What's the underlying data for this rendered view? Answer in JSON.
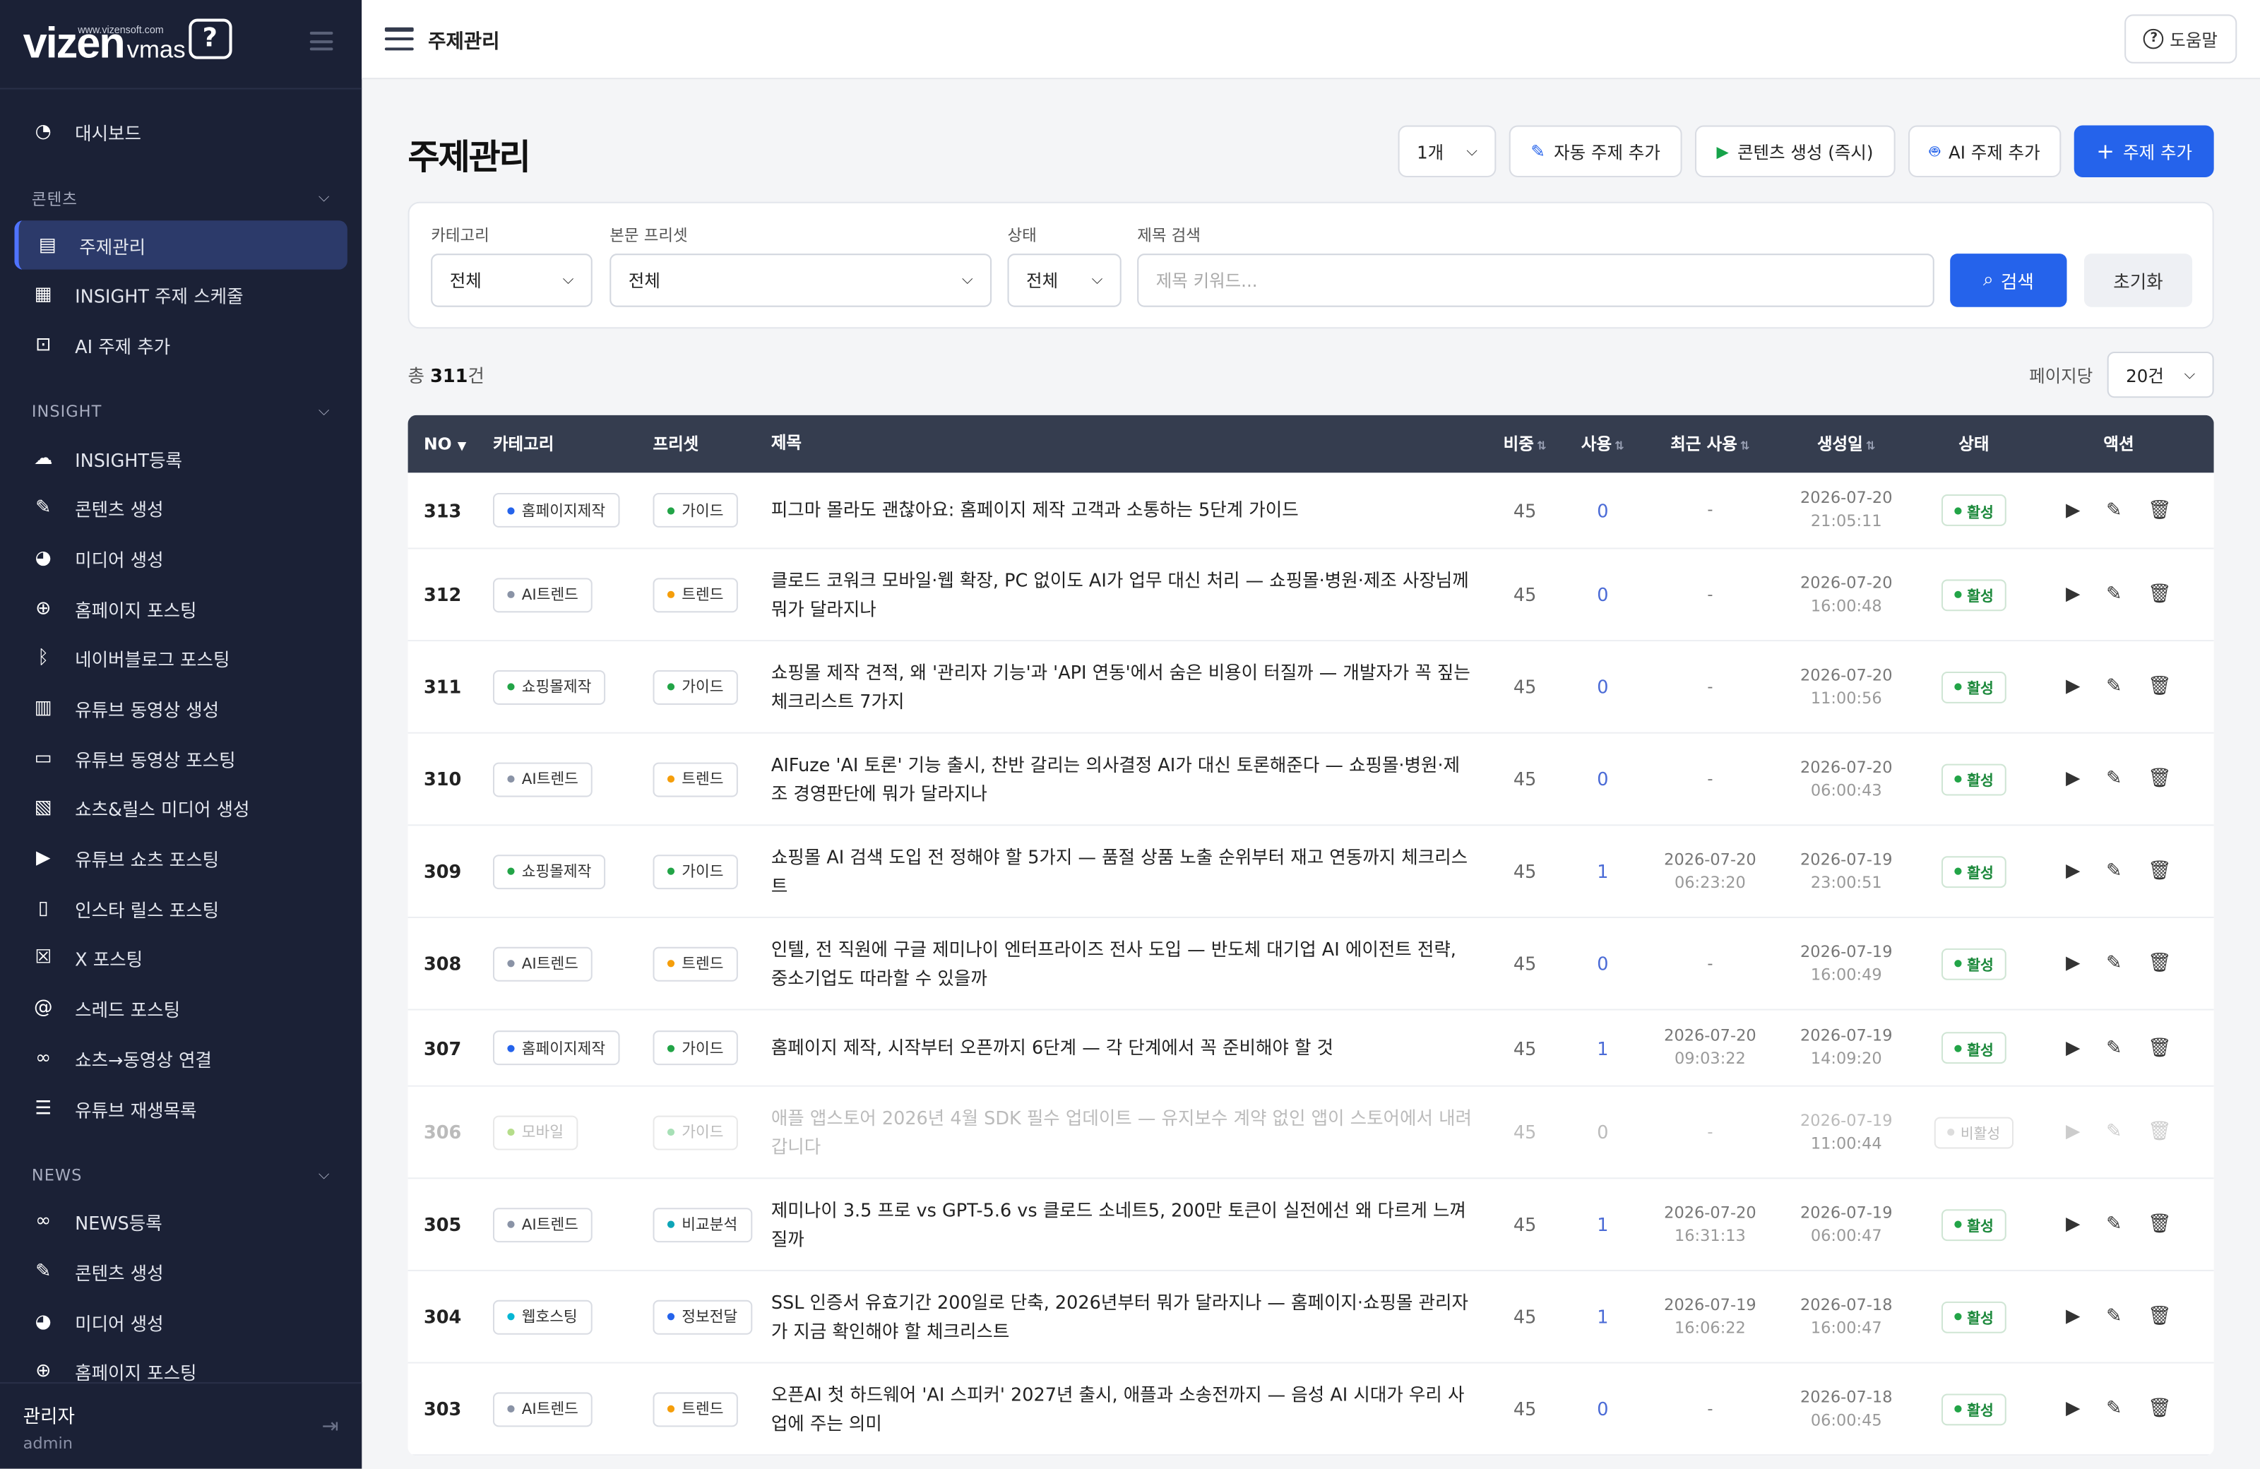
{
  "logo": {
    "word": "vizen",
    "sub": "vmas",
    "url": "www.vizensoft.com",
    "q": "?"
  },
  "sidebar": {
    "dashboard": "대시보드",
    "sections": [
      {
        "title": "콘텐츠",
        "items": [
          "주제관리",
          "INSIGHT 주제 스케줄",
          "AI 주제 추가"
        ]
      },
      {
        "title": "INSIGHT",
        "items": [
          "INSIGHT등록",
          "콘텐츠 생성",
          "미디어 생성",
          "홈페이지 포스팅",
          "네이버블로그 포스팅",
          "유튜브 동영상 생성",
          "유튜브 동영상 포스팅",
          "쇼츠&릴스 미디어 생성",
          "유튜브 쇼츠 포스팅",
          "인스타 릴스 포스팅",
          "X 포스팅",
          "스레드 포스팅",
          "쇼츠→동영상 연결",
          "유튜브 재생목록"
        ]
      },
      {
        "title": "NEWS",
        "items": [
          "NEWS등록",
          "콘텐츠 생성",
          "미디어 생성",
          "홈페이지 포스팅"
        ]
      }
    ],
    "user": {
      "name": "관리자",
      "role": "admin"
    }
  },
  "topbar": {
    "title": "주제관리",
    "help": "도움말"
  },
  "page": {
    "title": "주제관리"
  },
  "actions": {
    "count_select": "1개",
    "auto_add": "자동 주제 추가",
    "generate": "콘텐츠 생성 (즉시)",
    "ai_add": "AI 주제 추가",
    "add": "주제 추가"
  },
  "filter": {
    "category_label": "카테고리",
    "category_value": "전체",
    "preset_label": "본문 프리셋",
    "preset_value": "전체",
    "status_label": "상태",
    "status_value": "전체",
    "search_label": "제목 검색",
    "search_placeholder": "제목 키워드...",
    "search_button": "검색",
    "reset_button": "초기화"
  },
  "summary": {
    "prefix": "총 ",
    "count": "311",
    "suffix": "건",
    "per_page_label": "페이지당",
    "per_page_value": "20건"
  },
  "table": {
    "headers": {
      "no": "NO",
      "category": "카테고리",
      "preset": "프리셋",
      "title": "제목",
      "weight": "비중",
      "used": "사용",
      "recent": "최근 사용",
      "created": "생성일",
      "status": "상태",
      "action": "액션"
    },
    "rows": [
      {
        "no": "313",
        "cat": "홈페이지제작",
        "cat_color": "#2563eb",
        "preset": "가이드",
        "pre_color": "#22a447",
        "title": "피그마 몰라도 괜찮아요: 홈페이지 제작 고객과 소통하는 5단계 가이드",
        "weight": "45",
        "used": "0",
        "recent_d": "-",
        "recent_t": "",
        "created_d": "2026-07-20",
        "created_t": "21:05:11",
        "status": "활성",
        "active": true
      },
      {
        "no": "312",
        "cat": "AI트렌드",
        "cat_color": "#8a93a6",
        "preset": "트렌드",
        "pre_color": "#f59e0b",
        "title": "클로드 코워크 모바일·웹 확장, PC 없이도 AI가 업무 대신 처리 — 쇼핑몰·병원·제조 사장님께 뭐가 달라지나",
        "weight": "45",
        "used": "0",
        "recent_d": "-",
        "recent_t": "",
        "created_d": "2026-07-20",
        "created_t": "16:00:48",
        "status": "활성",
        "active": true
      },
      {
        "no": "311",
        "cat": "쇼핑몰제작",
        "cat_color": "#22a447",
        "preset": "가이드",
        "pre_color": "#22a447",
        "title": "쇼핑몰 제작 견적, 왜 '관리자 기능'과 'API 연동'에서 숨은 비용이 터질까 — 개발자가 꼭 짚는 체크리스트 7가지",
        "weight": "45",
        "used": "0",
        "recent_d": "-",
        "recent_t": "",
        "created_d": "2026-07-20",
        "created_t": "11:00:56",
        "status": "활성",
        "active": true
      },
      {
        "no": "310",
        "cat": "AI트렌드",
        "cat_color": "#8a93a6",
        "preset": "트렌드",
        "pre_color": "#f59e0b",
        "title": "AIFuze 'AI 토론' 기능 출시, 찬반 갈리는 의사결정 AI가 대신 토론해준다 — 쇼핑몰·병원·제조 경영판단에 뭐가 달라지나",
        "weight": "45",
        "used": "0",
        "recent_d": "-",
        "recent_t": "",
        "created_d": "2026-07-20",
        "created_t": "06:00:43",
        "status": "활성",
        "active": true
      },
      {
        "no": "309",
        "cat": "쇼핑몰제작",
        "cat_color": "#22a447",
        "preset": "가이드",
        "pre_color": "#22a447",
        "title": "쇼핑몰 AI 검색 도입 전 정해야 할 5가지 — 품절 상품 노출 순위부터 재고 연동까지 체크리스트",
        "weight": "45",
        "used": "1",
        "recent_d": "2026-07-20",
        "recent_t": "06:23:20",
        "created_d": "2026-07-19",
        "created_t": "23:00:51",
        "status": "활성",
        "active": true
      },
      {
        "no": "308",
        "cat": "AI트렌드",
        "cat_color": "#8a93a6",
        "preset": "트렌드",
        "pre_color": "#f59e0b",
        "title": "인텔, 전 직원에 구글 제미나이 엔터프라이즈 전사 도입 — 반도체 대기업 AI 에이전트 전략, 중소기업도 따라할 수 있을까",
        "weight": "45",
        "used": "0",
        "recent_d": "-",
        "recent_t": "",
        "created_d": "2026-07-19",
        "created_t": "16:00:49",
        "status": "활성",
        "active": true
      },
      {
        "no": "307",
        "cat": "홈페이지제작",
        "cat_color": "#2563eb",
        "preset": "가이드",
        "pre_color": "#22a447",
        "title": "홈페이지 제작, 시작부터 오픈까지 6단계 — 각 단계에서 꼭 준비해야 할 것",
        "weight": "45",
        "used": "1",
        "recent_d": "2026-07-20",
        "recent_t": "09:03:22",
        "created_d": "2026-07-19",
        "created_t": "14:09:20",
        "status": "활성",
        "active": true
      },
      {
        "no": "306",
        "cat": "모바일",
        "cat_color": "#b5dd8a",
        "preset": "가이드",
        "pre_color": "#a7e0b6",
        "title": "애플 앱스토어 2026년 4월 SDK 필수 업데이트 — 유지보수 계약 없인 앱이 스토어에서 내려갑니다",
        "weight": "45",
        "used": "0",
        "recent_d": "-",
        "recent_t": "",
        "created_d": "2026-07-19",
        "created_t": "11:00:44",
        "status": "비활성",
        "active": false
      },
      {
        "no": "305",
        "cat": "AI트렌드",
        "cat_color": "#8a93a6",
        "preset": "비교분석",
        "pre_color": "#0ea5b7",
        "title": "제미나이 3.5 프로 vs GPT-5.6 vs 클로드 소네트5, 200만 토큰이 실전에선 왜 다르게 느껴질까",
        "weight": "45",
        "used": "1",
        "recent_d": "2026-07-20",
        "recent_t": "16:31:13",
        "created_d": "2026-07-19",
        "created_t": "06:00:47",
        "status": "활성",
        "active": true
      },
      {
        "no": "304",
        "cat": "웹호스팅",
        "cat_color": "#06b6d4",
        "preset": "정보전달",
        "pre_color": "#2563eb",
        "title": "SSL 인증서 유효기간 200일로 단축, 2026년부터 뭐가 달라지나 — 홈페이지·쇼핑몰 관리자가 지금 확인해야 할 체크리스트",
        "weight": "45",
        "used": "1",
        "recent_d": "2026-07-19",
        "recent_t": "16:06:22",
        "created_d": "2026-07-18",
        "created_t": "16:00:47",
        "status": "활성",
        "active": true
      },
      {
        "no": "303",
        "cat": "AI트렌드",
        "cat_color": "#8a93a6",
        "preset": "트렌드",
        "pre_color": "#f59e0b",
        "title": "오픈AI 첫 하드웨어 'AI 스피커' 2027년 출시, 애플과 소송전까지 — 음성 AI 시대가 우리 사업에 주는 의미",
        "weight": "45",
        "used": "0",
        "recent_d": "-",
        "recent_t": "",
        "created_d": "2026-07-18",
        "created_t": "06:00:45",
        "status": "활성",
        "active": true
      }
    ]
  }
}
